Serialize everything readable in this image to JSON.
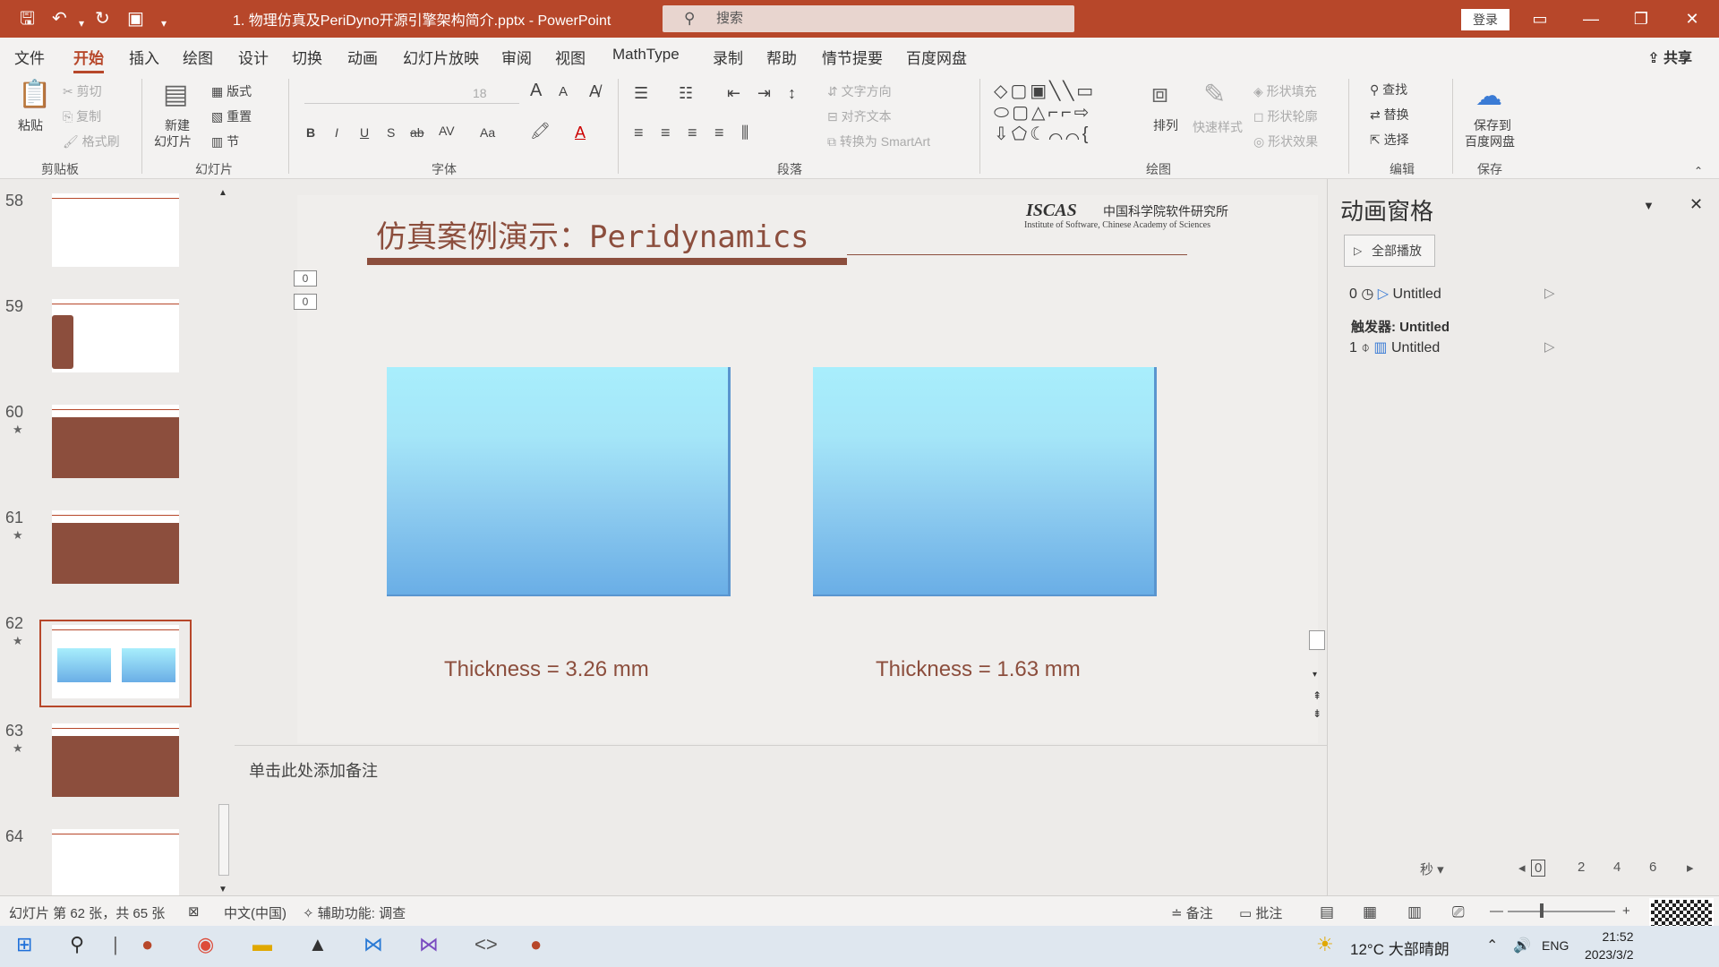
{
  "titlebar": {
    "doc_title": "1. 物理仿真及PeriDyno开源引擎架构简介.pptx - PowerPoint",
    "search_placeholder": "搜索",
    "login": "登录"
  },
  "menu": {
    "items": [
      "文件",
      "开始",
      "插入",
      "绘图",
      "设计",
      "切换",
      "动画",
      "幻灯片放映",
      "审阅",
      "视图",
      "MathType",
      "录制",
      "帮助",
      "情节提要",
      "百度网盘"
    ],
    "active": "开始",
    "share": "共享"
  },
  "ribbon": {
    "groups": {
      "clipboard": "剪贴板",
      "slides": "幻灯片",
      "font": "字体",
      "paragraph": "段落",
      "drawing": "绘图",
      "editing": "编辑",
      "save": "保存"
    },
    "clipboard": {
      "paste": "粘贴",
      "cut": "剪切",
      "copy": "复制",
      "format_painter": "格式刷"
    },
    "slides": {
      "new_slide_line1": "新建",
      "new_slide_line2": "幻灯片",
      "layout": "版式",
      "reset": "重置",
      "section": "节"
    },
    "font": {
      "size": "18",
      "bold": "B",
      "italic": "I",
      "underline": "U",
      "shadow": "S",
      "strike": "ab",
      "spacing": "AV",
      "case": "Aa"
    },
    "paragraph": {
      "text_direction": "文字方向",
      "align_text": "对齐文本",
      "smartart": "转换为 SmartArt"
    },
    "drawing": {
      "arrange": "排列",
      "quick_styles": "快速样式",
      "fill": "形状填充",
      "outline": "形状轮廓",
      "effects": "形状效果"
    },
    "editing": {
      "find": "查找",
      "replace": "替换",
      "select": "选择"
    },
    "save": {
      "line1": "保存到",
      "line2": "百度网盘"
    }
  },
  "thumbnails": {
    "slides": [
      {
        "num": "58",
        "star": ""
      },
      {
        "num": "59",
        "star": ""
      },
      {
        "num": "60",
        "star": "★"
      },
      {
        "num": "61",
        "star": "★"
      },
      {
        "num": "62",
        "star": "★"
      },
      {
        "num": "63",
        "star": "★"
      },
      {
        "num": "64",
        "star": ""
      }
    ]
  },
  "slide": {
    "title": "仿真案例演示：Peridynamics",
    "logo": "ISCAS",
    "logo_cn": "中国科学院软件研究所",
    "logo_en": "Institute of Software, Chinese Academy of Sciences",
    "anim_tags": [
      "0",
      "0"
    ],
    "left_label": "Thickness = 3.26 mm",
    "right_label": "Thickness = 1.63 mm"
  },
  "notes": {
    "placeholder": "单击此处添加备注"
  },
  "animation_pane": {
    "title": "动画窗格",
    "play_all": "全部播放",
    "items": [
      {
        "index": "0",
        "name": "Untitled"
      },
      {
        "index": "1",
        "name": "Untitled"
      }
    ],
    "trigger": "触发器: Untitled",
    "seconds": "秒",
    "timeline": [
      "0",
      "2",
      "4",
      "6"
    ]
  },
  "status": {
    "slide_info": "幻灯片 第 62 张，共 65 张",
    "language": "中文(中国)",
    "accessibility": "辅助功能: 调查",
    "notes": "备注",
    "comments": "批注"
  },
  "taskbar": {
    "weather": "12°C 大部晴朗",
    "lang": "ENG",
    "time": "21:52",
    "date": "2023/3/2"
  }
}
